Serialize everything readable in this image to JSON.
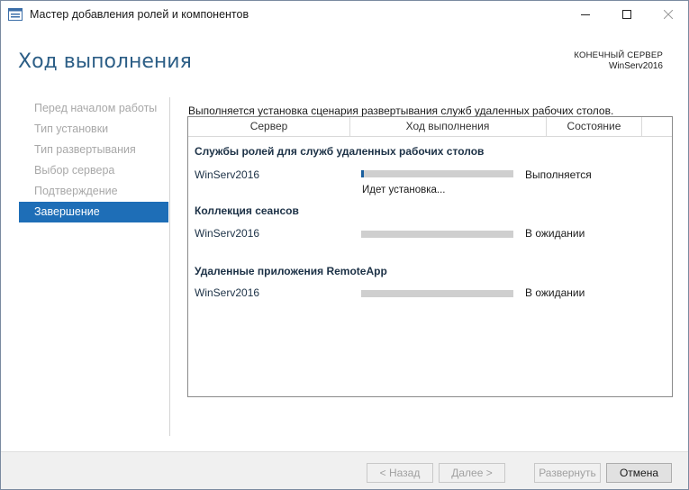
{
  "window": {
    "title": "Мастер добавления ролей и компонентов"
  },
  "header": {
    "page_title": "Ход выполнения",
    "destination_label": "КОНЕЧНЫЙ СЕРВЕР",
    "destination_server": "WinServ2016"
  },
  "nav": {
    "items": [
      {
        "label": "Перед началом работы",
        "active": false
      },
      {
        "label": "Тип установки",
        "active": false
      },
      {
        "label": "Тип развертывания",
        "active": false
      },
      {
        "label": "Выбор сервера",
        "active": false
      },
      {
        "label": "Подтверждение",
        "active": false
      },
      {
        "label": "Завершение",
        "active": true
      }
    ]
  },
  "content": {
    "status_line": "Выполняется установка сценария развертывания служб удаленных рабочих столов.",
    "table": {
      "columns": [
        "Сервер",
        "Ход выполнения",
        "Состояние"
      ],
      "groups": [
        {
          "title": "Службы ролей для служб удаленных рабочих столов",
          "rows": [
            {
              "server": "WinServ2016",
              "progress": 0.02,
              "status": "Выполняется",
              "detail": "Идет установка..."
            }
          ]
        },
        {
          "title": "Коллекция сеансов",
          "rows": [
            {
              "server": "WinServ2016",
              "progress": 0,
              "status": "В ожидании",
              "detail": ""
            }
          ]
        },
        {
          "title": "Удаленные приложения RemoteApp",
          "rows": [
            {
              "server": "WinServ2016",
              "progress": 0,
              "status": "В ожидании",
              "detail": ""
            }
          ]
        }
      ]
    }
  },
  "footer": {
    "back_label": "< Назад",
    "next_label": "Далее >",
    "install_label": "Развернуть",
    "cancel_label": "Отмена"
  },
  "colors": {
    "accent": "#1e6eb7",
    "title": "#2c5e86",
    "progress_fill": "#1a5f9e",
    "progress_track": "#cfcfcf"
  }
}
